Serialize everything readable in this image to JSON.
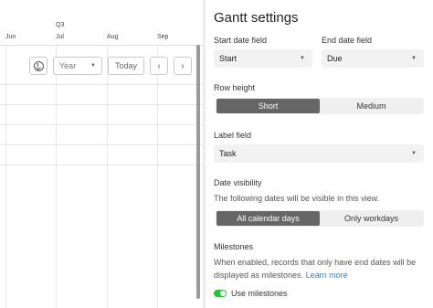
{
  "gantt": {
    "quarter": "Q3",
    "months": [
      "Jun",
      "Jul",
      "Aug",
      "Sep"
    ],
    "scale_select": "Year",
    "today_label": "Today",
    "prev_icon": "‹",
    "next_icon": "›"
  },
  "settings": {
    "title": "Gantt settings",
    "start_date": {
      "label": "Start date field",
      "value": "Start"
    },
    "end_date": {
      "label": "End date field",
      "value": "Due"
    },
    "row_height": {
      "label": "Row height",
      "options": [
        "Short",
        "Medium"
      ],
      "selected": "Short"
    },
    "label_field": {
      "label": "Label field",
      "value": "Task"
    },
    "date_visibility": {
      "label": "Date visibility",
      "description": "The following dates will be visible in this view.",
      "options": [
        "All calendar days",
        "Only workdays"
      ],
      "selected": "All calendar days"
    },
    "milestones": {
      "label": "Milestones",
      "description": "When enabled, records that only have end dates will be displayed as milestones.",
      "learn_more": "Learn more",
      "toggle_label": "Use milestones",
      "enabled": true
    }
  },
  "colors": {
    "accent_selected": "#666666",
    "toggle_on": "#20c933",
    "link": "#2d7ff9"
  }
}
